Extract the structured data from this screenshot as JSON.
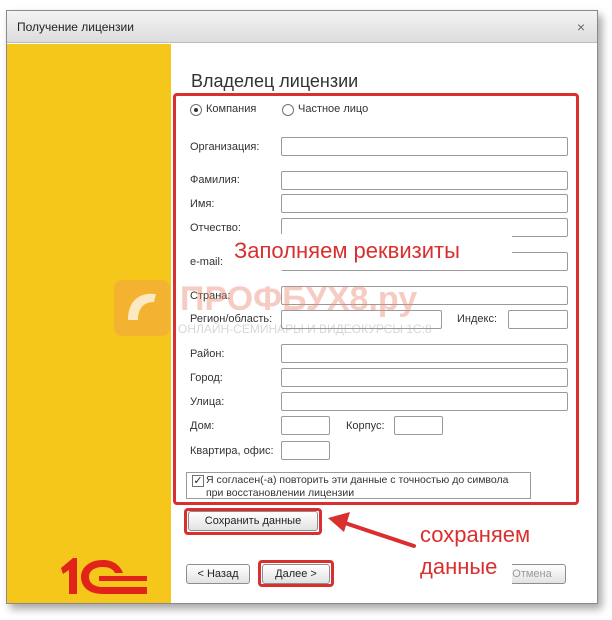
{
  "window": {
    "title": "Получение лицензии",
    "close_symbol": "×"
  },
  "page": {
    "heading": "Владелец лицензии"
  },
  "owner_type": {
    "options": [
      "Компания",
      "Частное лицо"
    ],
    "selected": "Компания"
  },
  "form": {
    "organization_label": "Организация:",
    "last_name_label": "Фамилия:",
    "first_name_label": "Имя:",
    "patronymic_label": "Отчество:",
    "email_label": "e-mail:",
    "country_label": "Страна:",
    "region_label": "Регион/область:",
    "index_label": "Индекс:",
    "district_label": "Район:",
    "city_label": "Город:",
    "street_label": "Улица:",
    "house_label": "Дом:",
    "building_label": "Корпус:",
    "apartment_label": "Квартира, офис:"
  },
  "agreement": {
    "checked": true,
    "check_mark": "✓",
    "line1": "Я согласен(-а) повторить эти данные с точностью до символа",
    "line2": "при восстановлении лицензии"
  },
  "buttons": {
    "save": "Сохранить данные",
    "back": "< Назад",
    "next": "Далее >",
    "cancel": "Отмена"
  },
  "annotations": {
    "fill_in": "Заполняем реквизиты",
    "save_line1": "сохраняем",
    "save_line2": "данные"
  },
  "watermark": {
    "brand": "ПРОФБУХ8.ру",
    "subtitle": "ОНЛАЙН-СЕМИНАРЫ И ВИДЕОКУРСЫ 1С:8"
  },
  "logo": {
    "text": "1С"
  },
  "colors": {
    "side_panel": "#f5c71a",
    "annotation_red": "#d9302f",
    "logo_red": "#e2231a"
  }
}
